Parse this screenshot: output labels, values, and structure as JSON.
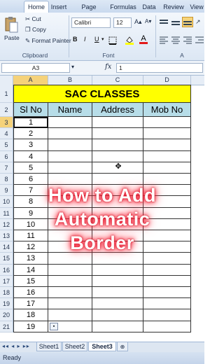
{
  "ribbon_tabs": [
    "Home",
    "Insert",
    "Page Layout",
    "Formulas",
    "Data",
    "Review",
    "View"
  ],
  "clipboard": {
    "paste": "Paste",
    "cut": "Cut",
    "copy": "Copy",
    "format_painter": "Format Painter",
    "group": "Clipboard"
  },
  "font": {
    "name": "Calibri",
    "size": "12",
    "bold": "B",
    "italic": "I",
    "underline": "U",
    "font_color_letter": "A",
    "group": "Font"
  },
  "alignment": {
    "group": "A"
  },
  "namebox": "A3",
  "formula": {
    "fx": "fx",
    "value": "1"
  },
  "columns": [
    "A",
    "B",
    "C",
    "D"
  ],
  "sheet": {
    "title": "SAC CLASSES",
    "headers": [
      "Sl No",
      "Name",
      "Address",
      "Mob No"
    ],
    "row_numbers": [
      "1",
      "2",
      "3",
      "4",
      "5",
      "6",
      "7",
      "8",
      "9",
      "10",
      "11",
      "12",
      "13",
      "14",
      "15",
      "16",
      "17",
      "18",
      "19",
      "20",
      "21"
    ],
    "serials": [
      "1",
      "2",
      "3",
      "4",
      "5",
      "6",
      "7",
      "8",
      "9",
      "10",
      "11",
      "12",
      "13",
      "14",
      "15",
      "16",
      "17",
      "18",
      "19"
    ]
  },
  "overlay_caption": [
    "How to Add",
    "Automatic",
    "Border"
  ],
  "sheet_tabs": [
    "Sheet1",
    "Sheet2",
    "Sheet3"
  ],
  "status_text": "Ready",
  "colors": {
    "title_fill": "#ffff00",
    "header_fill": "#b7dde8",
    "selected": "#f5c441"
  }
}
